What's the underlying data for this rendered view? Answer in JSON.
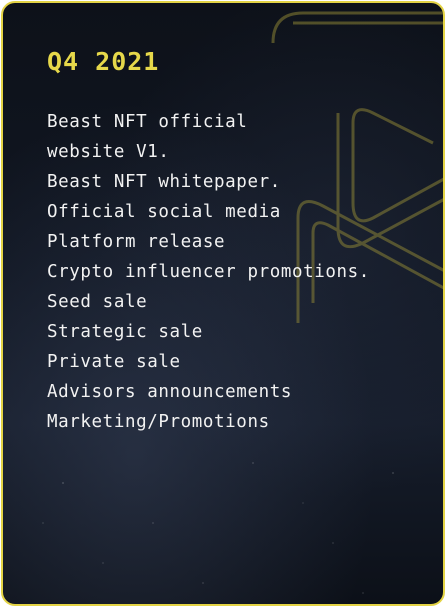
{
  "card": {
    "title": "Q4 2021",
    "items": [
      "Beast NFT official",
      "website V1.",
      "Beast NFT whitepaper.",
      "Official social media",
      "Platform release",
      "Crypto influencer promotions.",
      "Seed sale",
      "Strategic sale",
      "Private sale",
      "Advisors announcements",
      "Marketing/Promotions"
    ]
  },
  "colors": {
    "accent": "#e6d84a",
    "border": "#e3d345",
    "background": "#111723",
    "text": "#f2f2f2"
  },
  "icons": {
    "watermark": "beast-logo-outline-icon"
  }
}
